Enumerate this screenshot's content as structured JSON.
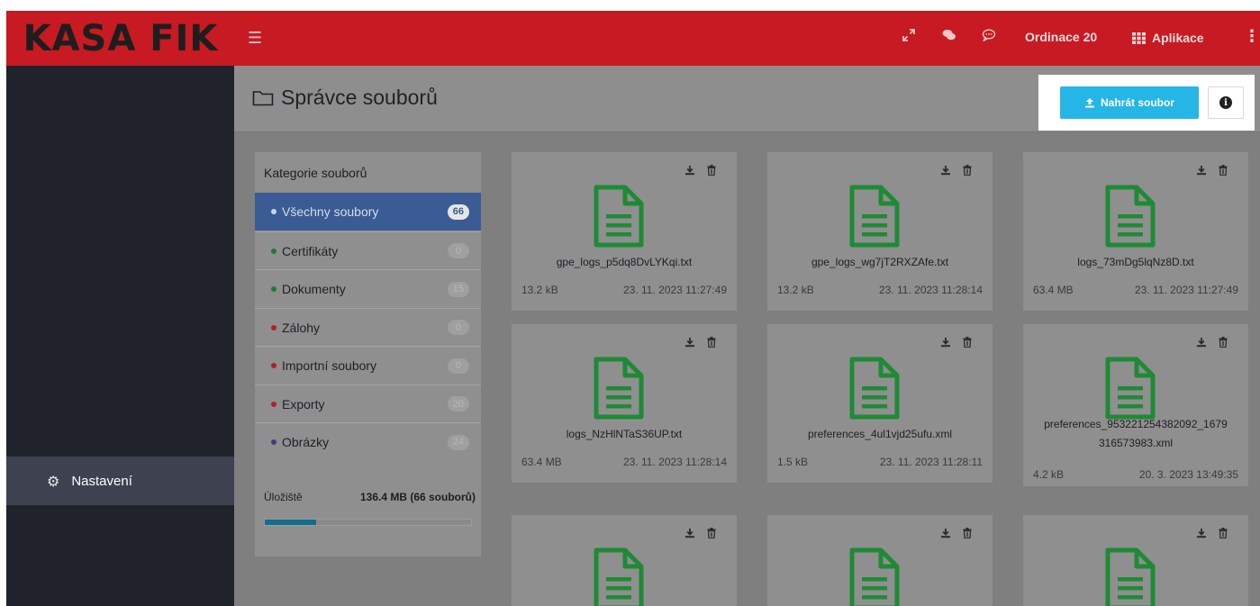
{
  "app": {
    "logo": "KASA FIK"
  },
  "topbar": {
    "menu_icon": "hamburger-icon",
    "icons": [
      "expand-icon",
      "comments-icon",
      "chat-bubble-icon"
    ],
    "ordinace_label": "Ordinace 20",
    "apps_label": "Aplikace",
    "more_icon": "kebab-icon"
  },
  "sidebar": {
    "items": [
      {
        "label": "Nastavení",
        "icon": "gear-icon"
      }
    ]
  },
  "page": {
    "title": "Správce souborů",
    "upload_label": "Nahrát soubor",
    "info_glyph": "i"
  },
  "categories": {
    "title": "Kategorie souborů",
    "items": [
      {
        "label": "Všechny soubory",
        "count": "66",
        "dot": "#c9d3e8",
        "active": true
      },
      {
        "label": "Certifikáty",
        "count": "0",
        "dot": "#1c7a3a"
      },
      {
        "label": "Dokumenty",
        "count": "15",
        "dot": "#1c7a3a"
      },
      {
        "label": "Zálohy",
        "count": "0",
        "dot": "#b0202a"
      },
      {
        "label": "Importní soubory",
        "count": "0",
        "dot": "#b0202a"
      },
      {
        "label": "Exporty",
        "count": "20",
        "dot": "#b0202a"
      },
      {
        "label": "Obrázky",
        "count": "24",
        "dot": "#3f3e7a"
      }
    ],
    "storage_label": "Úložiště",
    "storage_value": "136.4 MB (66 souborů)",
    "storage_fraction": 0.25
  },
  "files": [
    {
      "name": "gpe_logs_p5dq8DvLYKqi.txt",
      "size": "13.2 kB",
      "date": "23. 11. 2023 11:27:49"
    },
    {
      "name": "gpe_logs_wg7jT2RXZAfe.txt",
      "size": "13.2 kB",
      "date": "23. 11. 2023 11:28:14"
    },
    {
      "name": "logs_73mDg5lqNz8D.txt",
      "size": "63.4 MB",
      "date": "23. 11. 2023 11:27:49"
    },
    {
      "name": "logs_NzHlNTaS36UP.txt",
      "size": "63.4 MB",
      "date": "23. 11. 2023 11:28:14"
    },
    {
      "name": "preferences_4ul1vjd25ufu.xml",
      "size": "1.5 kB",
      "date": "23. 11. 2023 11:28:11"
    },
    {
      "name": "preferences_953221254382092_1679316573983.xml",
      "name_line1": "preferences_953221254382092_1679",
      "name_line2": "316573983.xml",
      "size": "4.2 kB",
      "date": "20. 3. 2023 13:49:35"
    }
  ],
  "colors": {
    "accent": "#c71a22",
    "upload": "#25b6e6",
    "file_icon": "#1f8a36",
    "active_category": "#3b5b95"
  }
}
